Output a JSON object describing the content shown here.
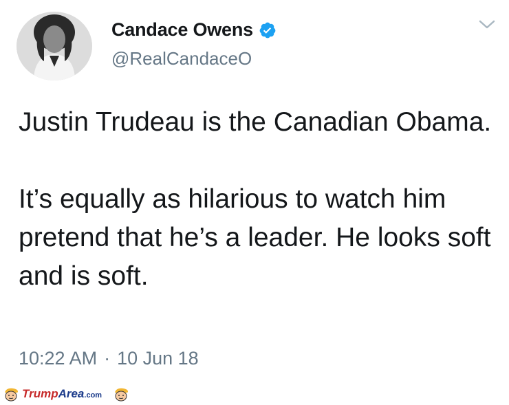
{
  "author": {
    "display_name": "Candace Owens",
    "handle": "@RealCandaceO",
    "verified": true,
    "avatar_icon": "profile-photo"
  },
  "tweet": {
    "paragraphs": [
      "Justin Trudeau is the Canadian Obama.",
      "It’s equally as hilarious to watch him pretend that he’s a leader. He looks soft and is soft."
    ],
    "time": "10:22 AM",
    "separator": "·",
    "date": "10 Jun 18"
  },
  "menu_icon": "chevron-down-icon",
  "watermark": {
    "brand_part1": "Trump",
    "brand_part2": "Area",
    "domain": ".com"
  },
  "colors": {
    "verified_blue": "#1da1f2",
    "secondary_text": "#657786",
    "primary_text": "#14171a"
  }
}
